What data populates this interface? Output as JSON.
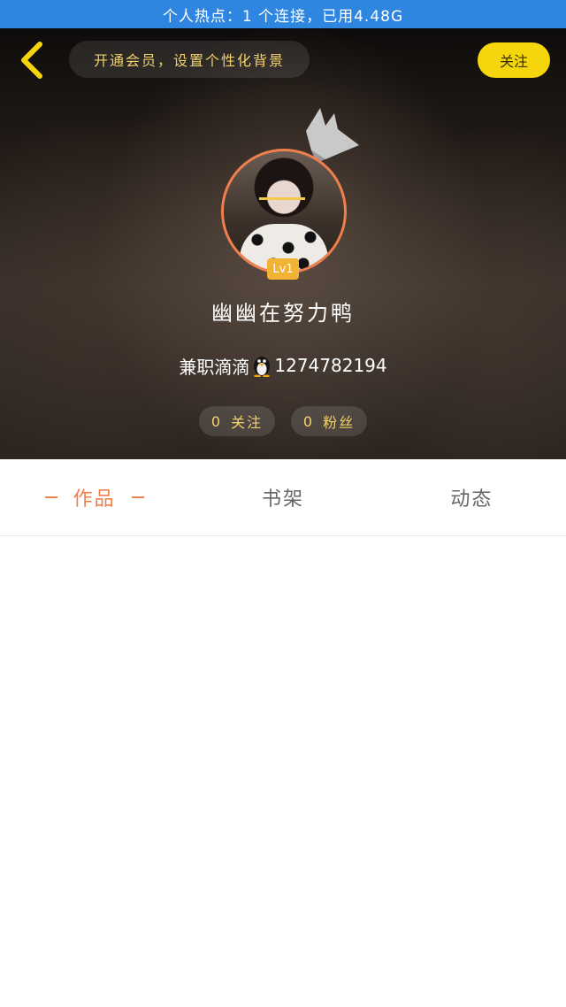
{
  "status_bar": {
    "text": "个人热点：1 个连接，已用4.48G"
  },
  "header": {
    "back_icon": "chevron-left-icon",
    "vip_banner": "开通会员，设置个性化背景",
    "follow_label": "关注"
  },
  "profile": {
    "level": "Lv1",
    "username": "幽幽在努力鸭",
    "qq_prefix": "兼职滴滴",
    "qq_icon": "penguin-icon",
    "qq_number": "1274782194",
    "following": {
      "count": "0",
      "label": "关注"
    },
    "followers": {
      "count": "0",
      "label": "粉丝"
    }
  },
  "tabs": [
    {
      "label": "作品",
      "active": true
    },
    {
      "label": "书架",
      "active": false
    },
    {
      "label": "动态",
      "active": false
    }
  ],
  "colors": {
    "status_bar": "#2f86e0",
    "accent": "#f07f4e",
    "follow_button": "#f5d60c",
    "gold_text": "#f3d26b",
    "level_badge": "#f2b233"
  }
}
